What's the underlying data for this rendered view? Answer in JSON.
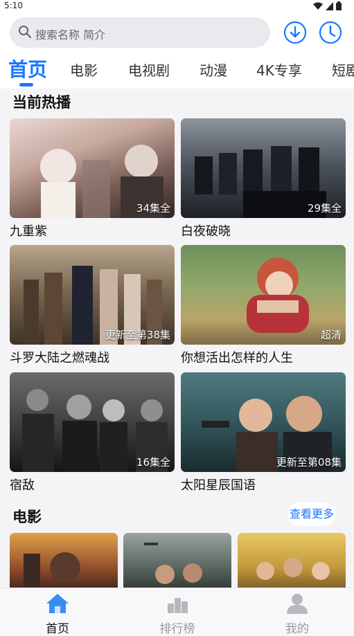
{
  "status": {
    "time": "5:10"
  },
  "search": {
    "placeholder": "搜索名称 简介"
  },
  "tabs": [
    "首页",
    "电影",
    "电视剧",
    "动漫",
    "4K专享",
    "短剧"
  ],
  "sections": {
    "now_playing": {
      "title": "当前热播",
      "items": [
        {
          "title": "九重紫",
          "badge": "34集全"
        },
        {
          "title": "白夜破晓",
          "badge": "29集全"
        },
        {
          "title": "斗罗大陆之燃魂战",
          "badge": "更新至第38集"
        },
        {
          "title": "你想活出怎样的人生",
          "badge": "超清"
        },
        {
          "title": "宿敌",
          "badge": "16集全"
        },
        {
          "title": "太阳星辰国语",
          "badge": "更新至第08集"
        }
      ]
    },
    "movies": {
      "title": "电影",
      "more": "查看更多"
    }
  },
  "bottom_nav": [
    {
      "label": "首页",
      "icon": "home-icon",
      "active": true
    },
    {
      "label": "排行榜",
      "icon": "ranking-icon",
      "active": false
    },
    {
      "label": "我的",
      "icon": "user-icon",
      "active": false
    }
  ],
  "colors": {
    "accent": "#1677ff",
    "background": "#f4f4f6"
  }
}
